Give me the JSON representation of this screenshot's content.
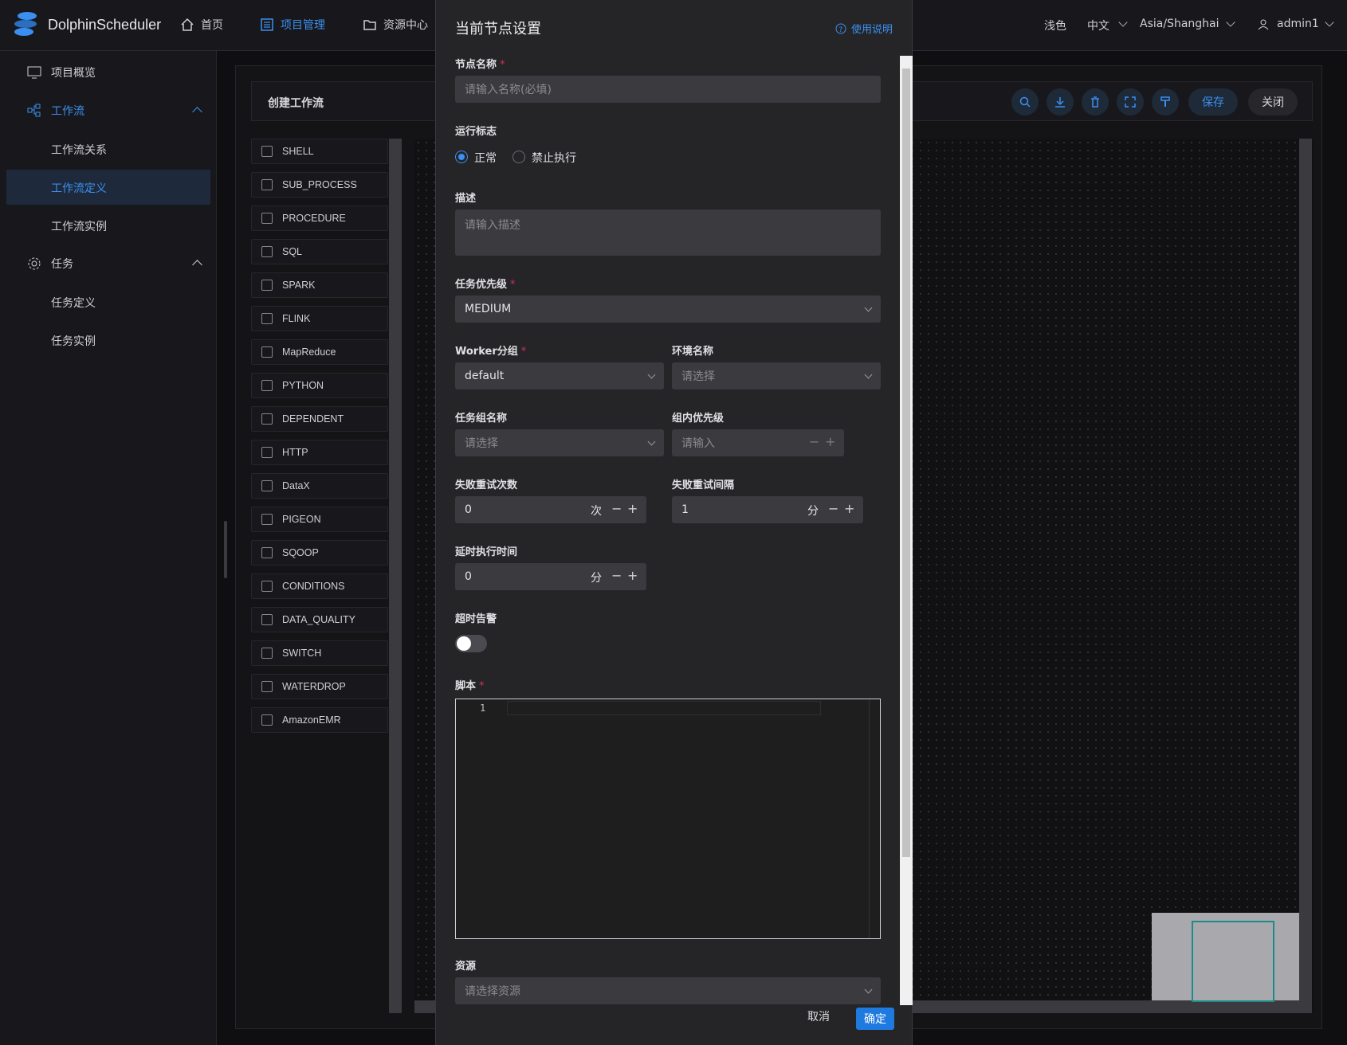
{
  "app": {
    "name": "DolphinScheduler"
  },
  "topnav": [
    {
      "label": "首页",
      "icon": "home-icon"
    },
    {
      "label": "项目管理",
      "icon": "project-icon",
      "active": true
    },
    {
      "label": "资源中心",
      "icon": "folder-icon"
    }
  ],
  "header_right": {
    "theme": "浅色",
    "language": "中文",
    "timezone": "Asia/Shanghai",
    "user": "admin1"
  },
  "sidebar": {
    "overview": "项目概览",
    "workflow": "工作流",
    "workflow_items": [
      "工作流关系",
      "工作流定义",
      "工作流实例"
    ],
    "task": "任务",
    "task_items": [
      "任务定义",
      "任务实例"
    ]
  },
  "toolbar": {
    "title": "创建工作流",
    "save": "保存",
    "close": "关闭"
  },
  "task_types": [
    "SHELL",
    "SUB_PROCESS",
    "PROCEDURE",
    "SQL",
    "SPARK",
    "FLINK",
    "MapReduce",
    "PYTHON",
    "DEPENDENT",
    "HTTP",
    "DataX",
    "PIGEON",
    "SQOOP",
    "CONDITIONS",
    "DATA_QUALITY",
    "SWITCH",
    "WATERDROP",
    "AmazonEMR"
  ],
  "drawer": {
    "title": "当前节点设置",
    "help": "使用说明",
    "node_name": {
      "label": "节点名称",
      "placeholder": "请输入名称(必填)"
    },
    "run_flag": {
      "label": "运行标志",
      "options": [
        "正常",
        "禁止执行"
      ],
      "selected": "正常"
    },
    "description": {
      "label": "描述",
      "placeholder": "请输入描述"
    },
    "priority": {
      "label": "任务优先级",
      "value": "MEDIUM"
    },
    "worker_group": {
      "label": "Worker分组",
      "value": "default"
    },
    "environment": {
      "label": "环境名称",
      "placeholder": "请选择"
    },
    "task_group": {
      "label": "任务组名称",
      "placeholder": "请选择"
    },
    "group_priority": {
      "label": "组内优先级",
      "placeholder": "请输入"
    },
    "retry_times": {
      "label": "失败重试次数",
      "value": "0",
      "unit": "次"
    },
    "retry_interval": {
      "label": "失败重试间隔",
      "value": "1",
      "unit": "分"
    },
    "delay_time": {
      "label": "延时执行时间",
      "value": "0",
      "unit": "分"
    },
    "timeout_alarm": {
      "label": "超时告警",
      "enabled": false
    },
    "script": {
      "label": "脚本",
      "line_number": "1"
    },
    "resource": {
      "label": "资源",
      "placeholder": "请选择资源"
    },
    "cancel": "取消",
    "confirm": "确定"
  },
  "colors": {
    "accent": "#3b8ff0",
    "required": "#d03050",
    "confirm": "#1f7ae0"
  }
}
